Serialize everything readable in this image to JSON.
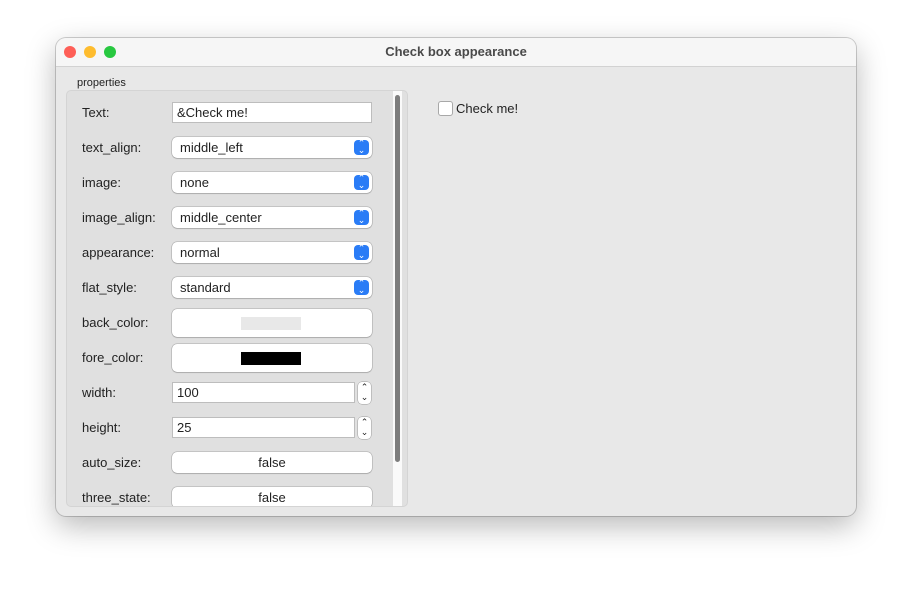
{
  "window": {
    "title": "Check box appearance"
  },
  "group_label": "properties",
  "properties": [
    {
      "label": "Text:",
      "type": "text",
      "value": "&Check me!"
    },
    {
      "label": "text_align:",
      "type": "select",
      "value": "middle_left"
    },
    {
      "label": "image:",
      "type": "select",
      "value": "none"
    },
    {
      "label": "image_align:",
      "type": "select",
      "value": "middle_center"
    },
    {
      "label": "appearance:",
      "type": "select",
      "value": "normal"
    },
    {
      "label": "flat_style:",
      "type": "select",
      "value": "standard"
    },
    {
      "label": "back_color:",
      "type": "color",
      "value": "#e8e8e8"
    },
    {
      "label": "fore_color:",
      "type": "color",
      "value": "#000000"
    },
    {
      "label": "width:",
      "type": "spin",
      "value": "100"
    },
    {
      "label": "height:",
      "type": "spin",
      "value": "25"
    },
    {
      "label": "auto_size:",
      "type": "button",
      "value": "false"
    },
    {
      "label": "three_state:",
      "type": "button",
      "value": "false"
    }
  ],
  "preview": {
    "checkbox_label": "Check me!",
    "checked": false
  }
}
